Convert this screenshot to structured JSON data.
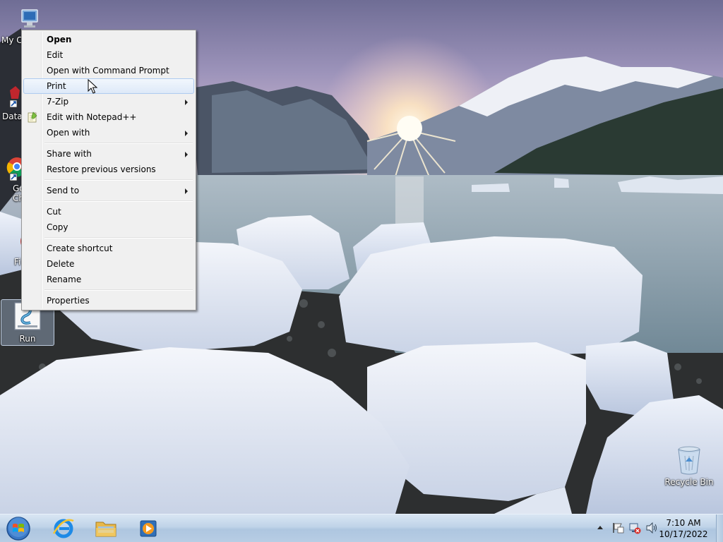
{
  "desktop": {
    "icons": [
      {
        "id": "computer",
        "label": "My C"
      },
      {
        "id": "data",
        "label": "Data"
      },
      {
        "id": "chrome",
        "label_line1": "Go",
        "label_line2": "Ch"
      },
      {
        "id": "firefox",
        "label": "Fi"
      },
      {
        "id": "run",
        "label": "Run"
      },
      {
        "id": "recycle",
        "label": "Recycle Bin"
      }
    ]
  },
  "context_menu": {
    "items": [
      {
        "label": "Open"
      },
      {
        "label": "Edit"
      },
      {
        "label": "Open with Command Prompt"
      },
      {
        "label": "Print"
      },
      {
        "label": "7-Zip"
      },
      {
        "label": "Edit with Notepad++"
      },
      {
        "label": "Open with"
      },
      {
        "label": "Share with"
      },
      {
        "label": "Restore previous versions"
      },
      {
        "label": "Send to"
      },
      {
        "label": "Cut"
      },
      {
        "label": "Copy"
      },
      {
        "label": "Create shortcut"
      },
      {
        "label": "Delete"
      },
      {
        "label": "Rename"
      },
      {
        "label": "Properties"
      }
    ]
  },
  "taskbar": {
    "pinned": [
      "internet-explorer-icon",
      "file-explorer-icon",
      "media-player-icon"
    ],
    "clock": {
      "time": "7:10 AM",
      "date": "10/17/2022"
    }
  },
  "colors": {
    "taskbar": "#bfd3e8",
    "menu_bg": "#f0f0f0",
    "menu_highlight": "#dde9f8"
  }
}
